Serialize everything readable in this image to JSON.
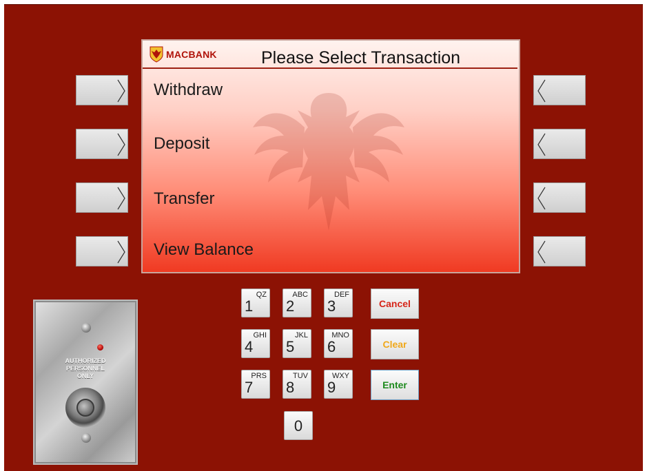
{
  "screen": {
    "brand": "MACBANK",
    "title": "Please Select Transaction",
    "options": [
      {
        "label": "Withdraw"
      },
      {
        "label": "Deposit"
      },
      {
        "label": "Transfer"
      },
      {
        "label": "View Balance"
      }
    ]
  },
  "keypad": {
    "keys": [
      {
        "digit": "1",
        "letters": "QZ"
      },
      {
        "digit": "2",
        "letters": "ABC"
      },
      {
        "digit": "3",
        "letters": "DEF"
      },
      {
        "digit": "4",
        "letters": "GHI"
      },
      {
        "digit": "5",
        "letters": "JKL"
      },
      {
        "digit": "6",
        "letters": "MNO"
      },
      {
        "digit": "7",
        "letters": "PRS"
      },
      {
        "digit": "8",
        "letters": "TUV"
      },
      {
        "digit": "9",
        "letters": "WXY"
      },
      {
        "digit": "0",
        "letters": ""
      }
    ],
    "cancel": "Cancel",
    "clear": "Clear",
    "enter": "Enter"
  },
  "plate": {
    "text": [
      "AUTHORIZED",
      "PERSONNEL",
      "ONLY"
    ]
  },
  "colors": {
    "housing": "#8c1204",
    "cancel": "#d62418",
    "clear": "#f0a81a",
    "enter": "#1d8a1d",
    "brand": "#b0130a"
  },
  "icons": {
    "left_buttons": "chevron-right-icon",
    "right_buttons": "chevron-left-icon",
    "logo": "eagle-crest-icon"
  }
}
